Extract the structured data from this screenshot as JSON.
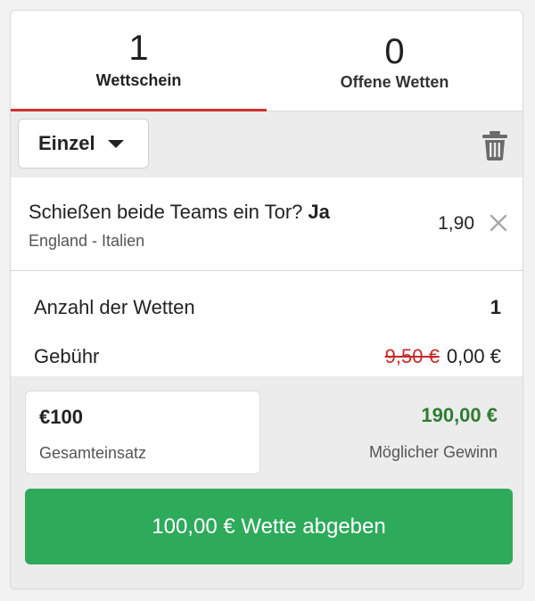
{
  "tabs": [
    {
      "count": "1",
      "label": "Wettschein",
      "active": true
    },
    {
      "count": "0",
      "label": "Offene Wetten",
      "active": false
    }
  ],
  "toolbar": {
    "bet_type": "Einzel",
    "delete_icon": "trash-icon"
  },
  "selection": {
    "market": "Schießen beide Teams ein Tor?",
    "pick": "Ja",
    "event": "England - Italien",
    "odds": "1,90",
    "remove_icon": "close-icon"
  },
  "summary": {
    "bets_label": "Anzahl der Wetten",
    "bets_value": "1",
    "fee_label": "Gebühr",
    "fee_old": "9,50 €",
    "fee_new": "0,00 €"
  },
  "stake": {
    "amount": "€100",
    "caption": "Gesamteinsatz"
  },
  "winnings": {
    "amount": "190,00 €",
    "caption": "Möglicher Gewinn"
  },
  "submit_label": "100,00 € Wette abgeben",
  "colors": {
    "accent_red": "#d32f2f",
    "win_green": "#2e7d32",
    "button_green": "#2eaa5b"
  }
}
